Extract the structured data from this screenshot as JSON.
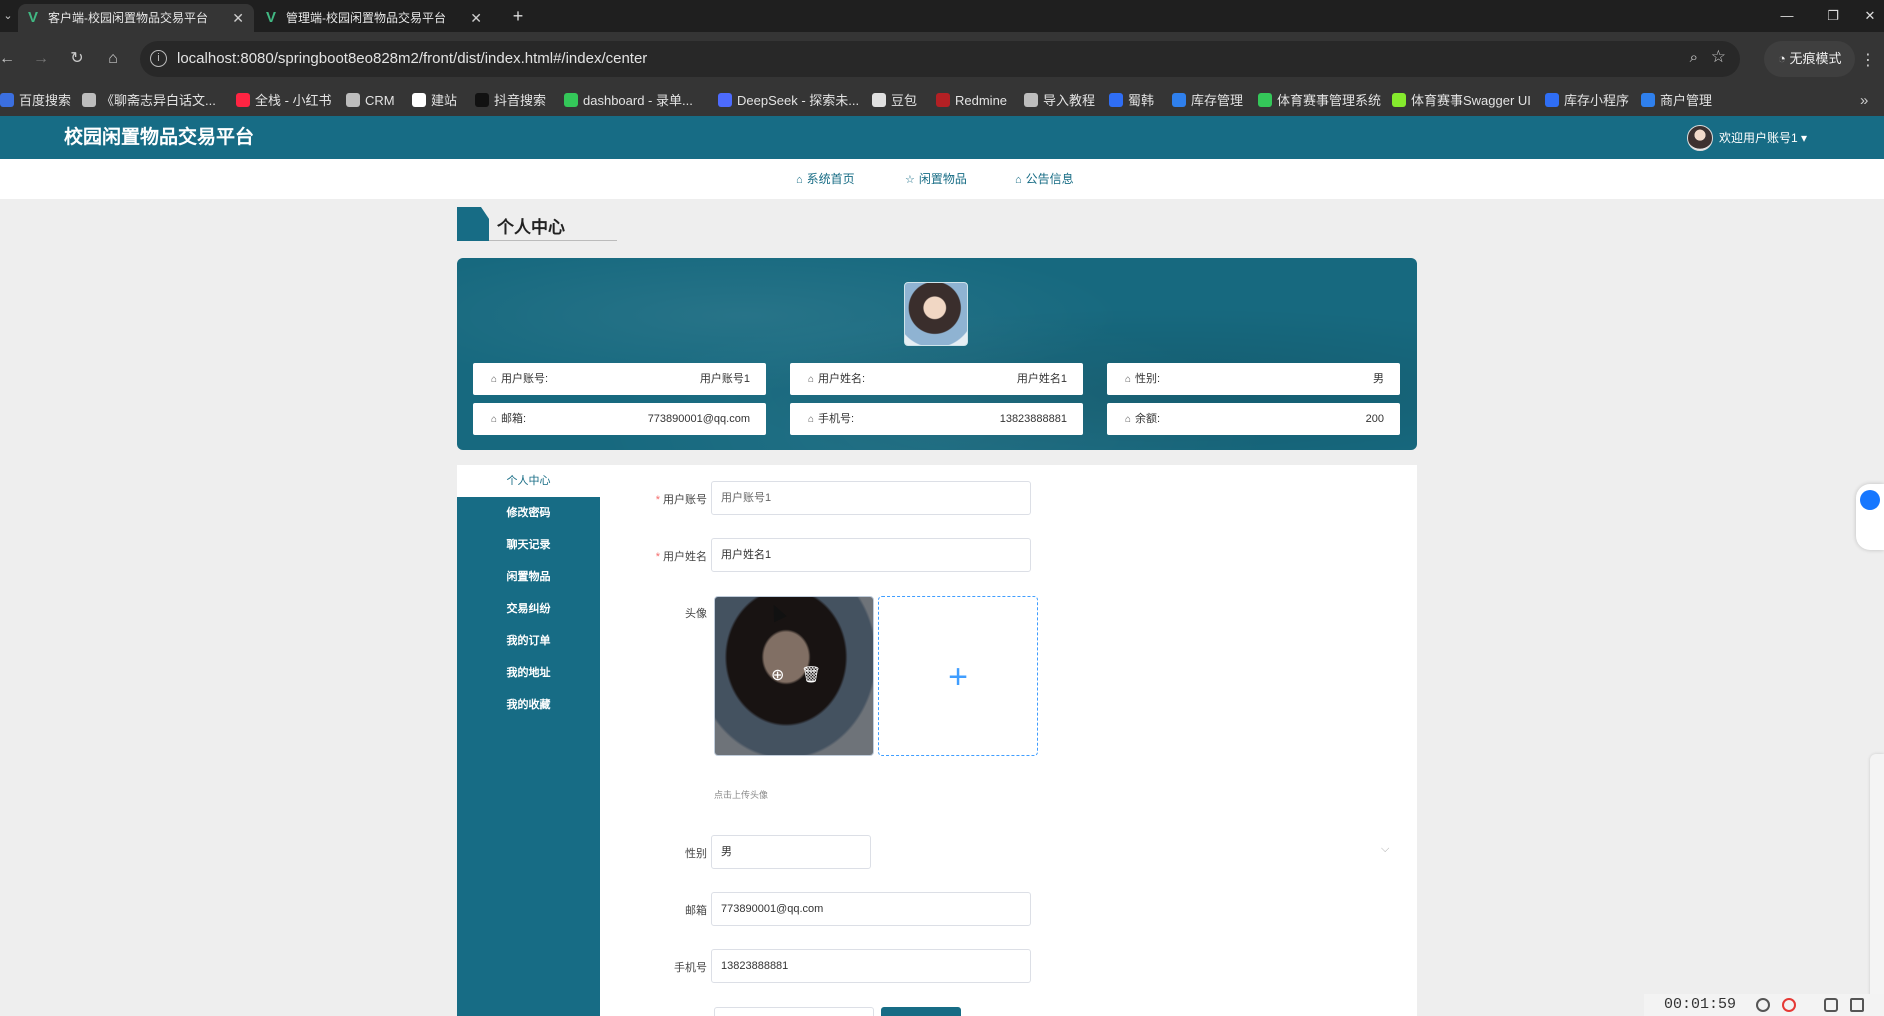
{
  "browser": {
    "tabs": [
      {
        "title": "客户端-校园闲置物品交易平台",
        "active": true
      },
      {
        "title": "管理端-校园闲置物品交易平台",
        "active": false
      }
    ],
    "url": "localhost:8080/springboot8eo828m2/front/dist/index.html#/index/center",
    "incognito_label": "无痕模式",
    "bookmarks": [
      {
        "label": "百度搜索",
        "color": "#3b6fe0"
      },
      {
        "label": "《聊斋志异白话文...",
        "color": "#bdbdbd"
      },
      {
        "label": "全栈 - 小红书",
        "color": "#ff2442"
      },
      {
        "label": "CRM",
        "color": "#bdbdbd"
      },
      {
        "label": "建站",
        "color": "#ffffff"
      },
      {
        "label": "抖音搜索",
        "color": "#111111"
      },
      {
        "label": "dashboard - 录单...",
        "color": "#34c759"
      },
      {
        "label": "DeepSeek - 探索未...",
        "color": "#4d6bfe"
      },
      {
        "label": "豆包",
        "color": "#e0e0e0"
      },
      {
        "label": "Redmine",
        "color": "#b32024"
      },
      {
        "label": "导入教程",
        "color": "#bdbdbd"
      },
      {
        "label": "蜀韩",
        "color": "#2f6ef5"
      },
      {
        "label": "库存管理",
        "color": "#2f80ed"
      },
      {
        "label": "体育赛事管理系统",
        "color": "#34c759"
      },
      {
        "label": "体育赛事Swagger UI",
        "color": "#85ea2d"
      },
      {
        "label": "库存小程序",
        "color": "#2f6ef5"
      },
      {
        "label": "商户管理",
        "color": "#2f80ed"
      }
    ]
  },
  "header": {
    "site_title": "校园闲置物品交易平台",
    "welcome": "欢迎用户账号1 ▾",
    "nav": [
      {
        "label": "系统首页",
        "icon": "home-icon"
      },
      {
        "label": "闲置物品",
        "icon": "star-icon"
      },
      {
        "label": "公告信息",
        "icon": "bag-icon"
      }
    ]
  },
  "page": {
    "section_title": "个人中心"
  },
  "profile": {
    "cells": [
      {
        "label": "用户账号:",
        "value": "用户账号1"
      },
      {
        "label": "用户姓名:",
        "value": "用户姓名1"
      },
      {
        "label": "性别:",
        "value": "男"
      },
      {
        "label": "邮箱:",
        "value": "773890001@qq.com"
      },
      {
        "label": "手机号:",
        "value": "13823888881"
      },
      {
        "label": "余额:",
        "value": "200"
      }
    ]
  },
  "sidebar": {
    "items": [
      {
        "label": "个人中心",
        "active": true
      },
      {
        "label": "修改密码"
      },
      {
        "label": "聊天记录"
      },
      {
        "label": "闲置物品"
      },
      {
        "label": "交易纠纷"
      },
      {
        "label": "我的订单"
      },
      {
        "label": "我的地址"
      },
      {
        "label": "我的收藏"
      }
    ]
  },
  "form": {
    "account_label": "用户账号",
    "account_placeholder": "用户账号1",
    "name_label": "用户姓名",
    "name_value": "用户姓名1",
    "avatar_label": "头像",
    "upload_tip": "点击上传头像",
    "gender_label": "性别",
    "gender_value": "男",
    "email_label": "邮箱",
    "email_value": "773890001@qq.com",
    "phone_label": "手机号",
    "phone_value": "13823888881"
  },
  "recorder": {
    "time": "00:01:59"
  },
  "colors": {
    "brand": "#176c85",
    "required": "#f56c6c",
    "upload_accent": "#409eff"
  }
}
